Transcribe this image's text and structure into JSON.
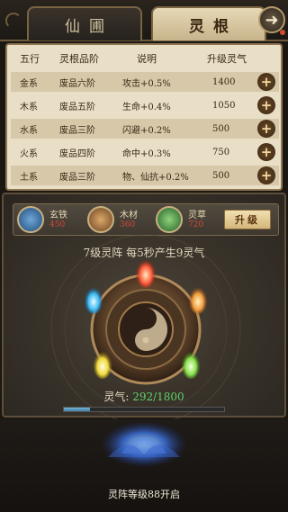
{
  "tabs": [
    {
      "label": "仙圃",
      "active": false
    },
    {
      "label": "灵根",
      "active": true
    }
  ],
  "table": {
    "headers": [
      "五行",
      "灵根品阶",
      "说明",
      "升级灵气"
    ],
    "rows": [
      {
        "element": "金系",
        "grade": "废品六阶",
        "desc": "攻击+0.5%",
        "cost": "1400"
      },
      {
        "element": "木系",
        "grade": "废品五阶",
        "desc": "生命+0.4%",
        "cost": "1050"
      },
      {
        "element": "水系",
        "grade": "废品三阶",
        "desc": "闪避+0.2%",
        "cost": "500"
      },
      {
        "element": "火系",
        "grade": "废品四阶",
        "desc": "命中+0.3%",
        "cost": "750"
      },
      {
        "element": "土系",
        "grade": "废品三阶",
        "desc": "物、仙抗+0.2%",
        "cost": "500"
      }
    ],
    "plus_symbol": "+"
  },
  "resources": [
    {
      "name": "玄铁",
      "value": "450",
      "icon": "iron-ore-icon"
    },
    {
      "name": "木材",
      "value": "360",
      "icon": "wood-logs-icon"
    },
    {
      "name": "灵草",
      "value": "720",
      "icon": "spirit-herb-icon"
    }
  ],
  "upgrade_label": "升级",
  "formation": {
    "rate_text": "7级灵阵 每5秒产生9灵气",
    "qi_label": "灵气:",
    "qi_value": "292/1800",
    "qi_progress": 0.162
  },
  "locked_text": "灵阵等级88开启",
  "colors": {
    "accent_gold": "#c9b080",
    "value_red": "#d2473a",
    "qi_green": "#5fd06a",
    "bar_blue": "#3f7fa8"
  }
}
